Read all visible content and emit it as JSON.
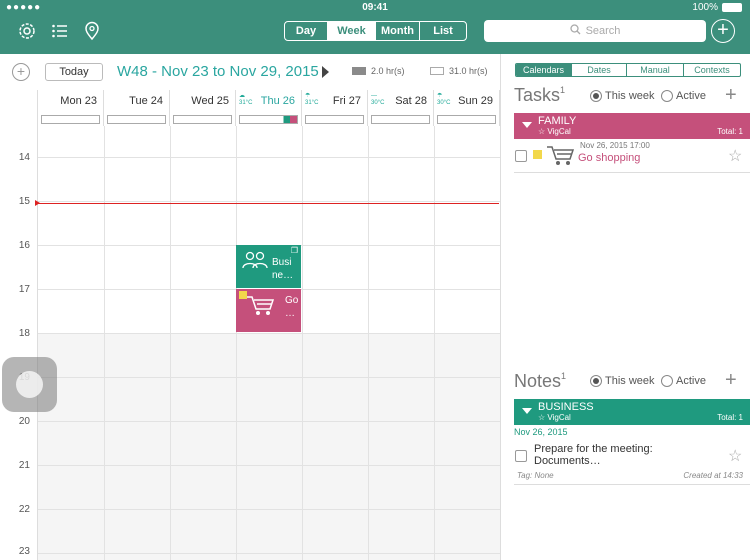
{
  "status": {
    "carrier": "●●●●● ",
    "time": "09:41",
    "battery": "100%"
  },
  "nav": {
    "views": [
      "Day",
      "Week",
      "Month",
      "List"
    ],
    "active_view": "Month",
    "search_placeholder": "Search"
  },
  "toolbar": {
    "today_label": "Today",
    "week_title": "W48 - Nov 23 to Nov 29, 2015",
    "legend_busy": "2.0 hr(s)",
    "legend_free": "31.0 hr(s)"
  },
  "days": [
    {
      "label": "Mon 23",
      "weather": ""
    },
    {
      "label": "Tue 24",
      "weather": ""
    },
    {
      "label": "Wed 25",
      "weather": ""
    },
    {
      "label": "Thu 26",
      "weather": "31°C"
    },
    {
      "label": "Fri 27",
      "weather": "31°C"
    },
    {
      "label": "Sat 28",
      "weather": "30°C"
    },
    {
      "label": "Sun 29",
      "weather": "30°C"
    }
  ],
  "hours": [
    "14",
    "15",
    "16",
    "17",
    "18",
    "19",
    "20",
    "21",
    "22",
    "23"
  ],
  "events": [
    {
      "title": "Busi ne…",
      "color": "#1f9a7f"
    },
    {
      "title": "Go …",
      "color": "#c5507b"
    }
  ],
  "right": {
    "tabs": [
      "Calendars",
      "Dates",
      "Manual",
      "Contexts"
    ],
    "active_tab": "Calendars",
    "tasks": {
      "title": "Tasks",
      "count": "1",
      "this_week": "This week",
      "active": "Active",
      "group": {
        "name": "FAMILY",
        "sub": "VigCal",
        "total": "Total: 1",
        "color": "#c5507b"
      },
      "items": [
        {
          "date": "Nov 26, 2015  17:00",
          "title": "Go shopping"
        }
      ]
    },
    "notes": {
      "title": "Notes",
      "count": "1",
      "this_week": "This week",
      "active": "Active",
      "group": {
        "name": "BUSINESS",
        "sub": "VigCal",
        "total": "Total: 1",
        "color": "#1f9a7f"
      },
      "date": "Nov 26, 2015",
      "items": [
        {
          "text": "Prepare for the meeting: Documents…",
          "tag": "Tag: None",
          "created": "Created at 14:33"
        }
      ]
    }
  }
}
